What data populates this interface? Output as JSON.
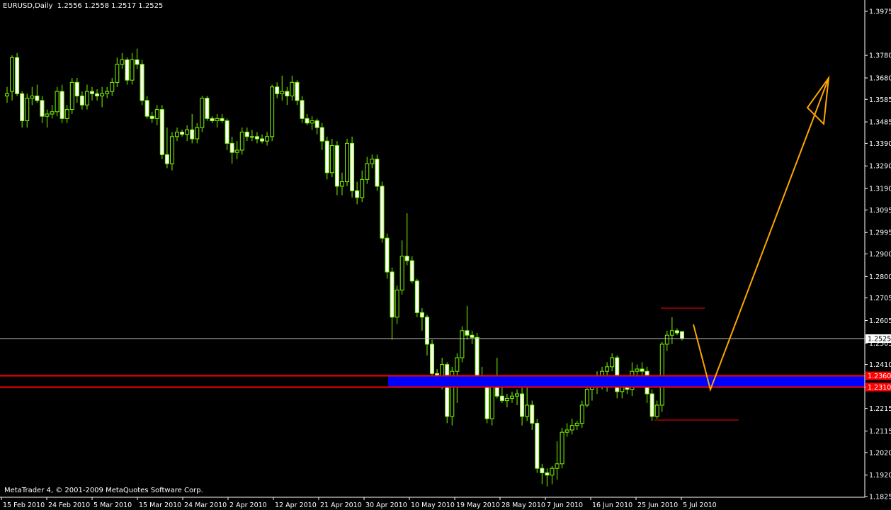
{
  "header": {
    "symbol": "EURUSD,Daily",
    "ohlc": "1.2556 1.2558 1.2517 1.2525"
  },
  "footer": {
    "copyright": "MetaTrader 4, © 2001-2009 MetaQuotes Software Corp."
  },
  "colors": {
    "background": "#000000",
    "candle": "#7CFC00",
    "candle_bull_body": "#000000",
    "candle_bear_body": "#FFFFFF",
    "support_band": "#0000FF",
    "support_lines": "#FF0000",
    "projection": "#FFA500",
    "price_line": "#C0C0C0",
    "axis_text": "#FFFFFF"
  },
  "chart_data": {
    "type": "candlestick",
    "symbol": "EURUSD",
    "timeframe": "Daily",
    "ylim": [
      1.1825,
      1.3975
    ],
    "y_ticks": [
      "1.3975",
      "1.3780",
      "1.3680",
      "1.3585",
      "1.3485",
      "1.3390",
      "1.3290",
      "1.3190",
      "1.3095",
      "1.2995",
      "1.2900",
      "1.2800",
      "1.2705",
      "1.2605",
      "1.2505",
      "1.2410",
      "1.2310",
      "1.2215",
      "1.2115",
      "1.2020",
      "1.1920",
      "1.1825"
    ],
    "x_ticks": [
      "15 Feb 2010",
      "24 Feb 2010",
      "5 Mar 2010",
      "15 Mar 2010",
      "24 Mar 2010",
      "2 Apr 2010",
      "12 Apr 2010",
      "21 Apr 2010",
      "30 Apr 2010",
      "10 May 2010",
      "19 May 2010",
      "28 May 2010",
      "7 Jun 2010",
      "16 Jun 2010",
      "25 Jun 2010",
      "5 Jul 2010"
    ],
    "current_price": "1.2525",
    "levels": [
      {
        "label": "1.2360",
        "price": 1.236
      },
      {
        "label": "1.2310",
        "price": 1.231
      }
    ],
    "zone_band": {
      "top": 1.236,
      "bottom": 1.231
    },
    "candles": [
      {
        "o": 1.36,
        "h": 1.364,
        "l": 1.357,
        "c": 1.361
      },
      {
        "o": 1.362,
        "h": 1.378,
        "l": 1.358,
        "c": 1.377
      },
      {
        "o": 1.377,
        "h": 1.379,
        "l": 1.36,
        "c": 1.361
      },
      {
        "o": 1.361,
        "h": 1.362,
        "l": 1.346,
        "c": 1.349
      },
      {
        "o": 1.349,
        "h": 1.361,
        "l": 1.346,
        "c": 1.359
      },
      {
        "o": 1.359,
        "h": 1.364,
        "l": 1.356,
        "c": 1.36
      },
      {
        "o": 1.36,
        "h": 1.365,
        "l": 1.357,
        "c": 1.358
      },
      {
        "o": 1.358,
        "h": 1.36,
        "l": 1.348,
        "c": 1.351
      },
      {
        "o": 1.351,
        "h": 1.354,
        "l": 1.346,
        "c": 1.352
      },
      {
        "o": 1.352,
        "h": 1.356,
        "l": 1.35,
        "c": 1.353
      },
      {
        "o": 1.353,
        "h": 1.364,
        "l": 1.351,
        "c": 1.362
      },
      {
        "o": 1.362,
        "h": 1.365,
        "l": 1.348,
        "c": 1.35
      },
      {
        "o": 1.35,
        "h": 1.356,
        "l": 1.348,
        "c": 1.354
      },
      {
        "o": 1.354,
        "h": 1.368,
        "l": 1.352,
        "c": 1.366
      },
      {
        "o": 1.366,
        "h": 1.368,
        "l": 1.357,
        "c": 1.36
      },
      {
        "o": 1.36,
        "h": 1.362,
        "l": 1.354,
        "c": 1.356
      },
      {
        "o": 1.356,
        "h": 1.365,
        "l": 1.354,
        "c": 1.362
      },
      {
        "o": 1.362,
        "h": 1.364,
        "l": 1.358,
        "c": 1.361
      },
      {
        "o": 1.361,
        "h": 1.363,
        "l": 1.358,
        "c": 1.36
      },
      {
        "o": 1.36,
        "h": 1.364,
        "l": 1.355,
        "c": 1.361
      },
      {
        "o": 1.361,
        "h": 1.364,
        "l": 1.359,
        "c": 1.362
      },
      {
        "o": 1.362,
        "h": 1.368,
        "l": 1.36,
        "c": 1.366
      },
      {
        "o": 1.366,
        "h": 1.377,
        "l": 1.364,
        "c": 1.374
      },
      {
        "o": 1.374,
        "h": 1.379,
        "l": 1.372,
        "c": 1.376
      },
      {
        "o": 1.376,
        "h": 1.377,
        "l": 1.365,
        "c": 1.367
      },
      {
        "o": 1.367,
        "h": 1.379,
        "l": 1.365,
        "c": 1.376
      },
      {
        "o": 1.376,
        "h": 1.381,
        "l": 1.372,
        "c": 1.374
      },
      {
        "o": 1.374,
        "h": 1.376,
        "l": 1.356,
        "c": 1.358
      },
      {
        "o": 1.358,
        "h": 1.36,
        "l": 1.35,
        "c": 1.351
      },
      {
        "o": 1.351,
        "h": 1.353,
        "l": 1.348,
        "c": 1.35
      },
      {
        "o": 1.35,
        "h": 1.356,
        "l": 1.347,
        "c": 1.354
      },
      {
        "o": 1.354,
        "h": 1.356,
        "l": 1.332,
        "c": 1.334
      },
      {
        "o": 1.334,
        "h": 1.346,
        "l": 1.328,
        "c": 1.33
      },
      {
        "o": 1.33,
        "h": 1.344,
        "l": 1.327,
        "c": 1.342
      },
      {
        "o": 1.342,
        "h": 1.346,
        "l": 1.34,
        "c": 1.344
      },
      {
        "o": 1.344,
        "h": 1.345,
        "l": 1.342,
        "c": 1.343
      },
      {
        "o": 1.343,
        "h": 1.347,
        "l": 1.34,
        "c": 1.345
      },
      {
        "o": 1.345,
        "h": 1.352,
        "l": 1.339,
        "c": 1.341
      },
      {
        "o": 1.341,
        "h": 1.348,
        "l": 1.339,
        "c": 1.346
      },
      {
        "o": 1.346,
        "h": 1.36,
        "l": 1.344,
        "c": 1.359
      },
      {
        "o": 1.359,
        "h": 1.36,
        "l": 1.349,
        "c": 1.35
      },
      {
        "o": 1.35,
        "h": 1.351,
        "l": 1.348,
        "c": 1.349
      },
      {
        "o": 1.349,
        "h": 1.352,
        "l": 1.346,
        "c": 1.35
      },
      {
        "o": 1.35,
        "h": 1.352,
        "l": 1.348,
        "c": 1.349
      },
      {
        "o": 1.349,
        "h": 1.35,
        "l": 1.336,
        "c": 1.339
      },
      {
        "o": 1.339,
        "h": 1.342,
        "l": 1.33,
        "c": 1.335
      },
      {
        "o": 1.335,
        "h": 1.34,
        "l": 1.332,
        "c": 1.336
      },
      {
        "o": 1.336,
        "h": 1.346,
        "l": 1.334,
        "c": 1.344
      },
      {
        "o": 1.344,
        "h": 1.346,
        "l": 1.34,
        "c": 1.342
      },
      {
        "o": 1.342,
        "h": 1.345,
        "l": 1.34,
        "c": 1.342
      },
      {
        "o": 1.342,
        "h": 1.344,
        "l": 1.339,
        "c": 1.341
      },
      {
        "o": 1.341,
        "h": 1.343,
        "l": 1.339,
        "c": 1.34
      },
      {
        "o": 1.34,
        "h": 1.344,
        "l": 1.338,
        "c": 1.342
      },
      {
        "o": 1.342,
        "h": 1.365,
        "l": 1.34,
        "c": 1.364
      },
      {
        "o": 1.364,
        "h": 1.366,
        "l": 1.359,
        "c": 1.361
      },
      {
        "o": 1.361,
        "h": 1.369,
        "l": 1.358,
        "c": 1.362
      },
      {
        "o": 1.362,
        "h": 1.364,
        "l": 1.356,
        "c": 1.36
      },
      {
        "o": 1.36,
        "h": 1.369,
        "l": 1.358,
        "c": 1.366
      },
      {
        "o": 1.366,
        "h": 1.367,
        "l": 1.356,
        "c": 1.358
      },
      {
        "o": 1.358,
        "h": 1.36,
        "l": 1.348,
        "c": 1.35
      },
      {
        "o": 1.35,
        "h": 1.352,
        "l": 1.347,
        "c": 1.348
      },
      {
        "o": 1.348,
        "h": 1.351,
        "l": 1.345,
        "c": 1.349
      },
      {
        "o": 1.349,
        "h": 1.35,
        "l": 1.343,
        "c": 1.346
      },
      {
        "o": 1.346,
        "h": 1.348,
        "l": 1.336,
        "c": 1.34
      },
      {
        "o": 1.34,
        "h": 1.342,
        "l": 1.323,
        "c": 1.326
      },
      {
        "o": 1.326,
        "h": 1.341,
        "l": 1.324,
        "c": 1.338
      },
      {
        "o": 1.338,
        "h": 1.34,
        "l": 1.316,
        "c": 1.32
      },
      {
        "o": 1.32,
        "h": 1.326,
        "l": 1.316,
        "c": 1.322
      },
      {
        "o": 1.322,
        "h": 1.341,
        "l": 1.32,
        "c": 1.339
      },
      {
        "o": 1.339,
        "h": 1.342,
        "l": 1.315,
        "c": 1.318
      },
      {
        "o": 1.318,
        "h": 1.322,
        "l": 1.312,
        "c": 1.315
      },
      {
        "o": 1.315,
        "h": 1.327,
        "l": 1.313,
        "c": 1.323
      },
      {
        "o": 1.323,
        "h": 1.333,
        "l": 1.321,
        "c": 1.33
      },
      {
        "o": 1.33,
        "h": 1.334,
        "l": 1.328,
        "c": 1.332
      },
      {
        "o": 1.332,
        "h": 1.334,
        "l": 1.318,
        "c": 1.32
      },
      {
        "o": 1.32,
        "h": 1.322,
        "l": 1.295,
        "c": 1.297
      },
      {
        "o": 1.297,
        "h": 1.299,
        "l": 1.279,
        "c": 1.282
      },
      {
        "o": 1.282,
        "h": 1.284,
        "l": 1.252,
        "c": 1.262
      },
      {
        "o": 1.262,
        "h": 1.276,
        "l": 1.259,
        "c": 1.274
      },
      {
        "o": 1.274,
        "h": 1.296,
        "l": 1.272,
        "c": 1.289
      },
      {
        "o": 1.289,
        "h": 1.308,
        "l": 1.285,
        "c": 1.287
      },
      {
        "o": 1.287,
        "h": 1.289,
        "l": 1.277,
        "c": 1.278
      },
      {
        "o": 1.278,
        "h": 1.279,
        "l": 1.262,
        "c": 1.264
      },
      {
        "o": 1.264,
        "h": 1.266,
        "l": 1.256,
        "c": 1.262
      },
      {
        "o": 1.262,
        "h": 1.263,
        "l": 1.245,
        "c": 1.25
      },
      {
        "o": 1.25,
        "h": 1.252,
        "l": 1.235,
        "c": 1.237
      },
      {
        "o": 1.237,
        "h": 1.239,
        "l": 1.234,
        "c": 1.236
      },
      {
        "o": 1.236,
        "h": 1.244,
        "l": 1.23,
        "c": 1.241
      },
      {
        "o": 1.241,
        "h": 1.242,
        "l": 1.215,
        "c": 1.218
      },
      {
        "o": 1.218,
        "h": 1.24,
        "l": 1.214,
        "c": 1.238
      },
      {
        "o": 1.238,
        "h": 1.246,
        "l": 1.224,
        "c": 1.244
      },
      {
        "o": 1.244,
        "h": 1.258,
        "l": 1.242,
        "c": 1.256
      },
      {
        "o": 1.256,
        "h": 1.267,
        "l": 1.252,
        "c": 1.254
      },
      {
        "o": 1.254,
        "h": 1.256,
        "l": 1.25,
        "c": 1.253
      },
      {
        "o": 1.253,
        "h": 1.255,
        "l": 1.233,
        "c": 1.235
      },
      {
        "o": 1.235,
        "h": 1.24,
        "l": 1.231,
        "c": 1.234
      },
      {
        "o": 1.234,
        "h": 1.236,
        "l": 1.215,
        "c": 1.217
      },
      {
        "o": 1.217,
        "h": 1.236,
        "l": 1.214,
        "c": 1.233
      },
      {
        "o": 1.233,
        "h": 1.244,
        "l": 1.226,
        "c": 1.227
      },
      {
        "o": 1.227,
        "h": 1.233,
        "l": 1.224,
        "c": 1.225
      },
      {
        "o": 1.225,
        "h": 1.228,
        "l": 1.222,
        "c": 1.226
      },
      {
        "o": 1.226,
        "h": 1.229,
        "l": 1.224,
        "c": 1.227
      },
      {
        "o": 1.227,
        "h": 1.23,
        "l": 1.223,
        "c": 1.228
      },
      {
        "o": 1.228,
        "h": 1.231,
        "l": 1.214,
        "c": 1.218
      },
      {
        "o": 1.218,
        "h": 1.234,
        "l": 1.216,
        "c": 1.223
      },
      {
        "o": 1.223,
        "h": 1.225,
        "l": 1.212,
        "c": 1.215
      },
      {
        "o": 1.215,
        "h": 1.217,
        "l": 1.193,
        "c": 1.195
      },
      {
        "o": 1.195,
        "h": 1.197,
        "l": 1.188,
        "c": 1.193
      },
      {
        "o": 1.193,
        "h": 1.195,
        "l": 1.187,
        "c": 1.192
      },
      {
        "o": 1.192,
        "h": 1.196,
        "l": 1.188,
        "c": 1.195
      },
      {
        "o": 1.195,
        "h": 1.207,
        "l": 1.19,
        "c": 1.197
      },
      {
        "o": 1.197,
        "h": 1.213,
        "l": 1.195,
        "c": 1.211
      },
      {
        "o": 1.211,
        "h": 1.215,
        "l": 1.209,
        "c": 1.212
      },
      {
        "o": 1.212,
        "h": 1.217,
        "l": 1.21,
        "c": 1.214
      },
      {
        "o": 1.214,
        "h": 1.216,
        "l": 1.212,
        "c": 1.215
      },
      {
        "o": 1.215,
        "h": 1.225,
        "l": 1.213,
        "c": 1.223
      },
      {
        "o": 1.223,
        "h": 1.234,
        "l": 1.222,
        "c": 1.23
      },
      {
        "o": 1.23,
        "h": 1.233,
        "l": 1.225,
        "c": 1.231
      },
      {
        "o": 1.231,
        "h": 1.238,
        "l": 1.228,
        "c": 1.236
      },
      {
        "o": 1.236,
        "h": 1.24,
        "l": 1.23,
        "c": 1.238
      },
      {
        "o": 1.238,
        "h": 1.242,
        "l": 1.229,
        "c": 1.24
      },
      {
        "o": 1.24,
        "h": 1.246,
        "l": 1.238,
        "c": 1.244
      },
      {
        "o": 1.244,
        "h": 1.245,
        "l": 1.226,
        "c": 1.229
      },
      {
        "o": 1.229,
        "h": 1.234,
        "l": 1.226,
        "c": 1.233
      },
      {
        "o": 1.233,
        "h": 1.236,
        "l": 1.228,
        "c": 1.23
      },
      {
        "o": 1.23,
        "h": 1.242,
        "l": 1.227,
        "c": 1.238
      },
      {
        "o": 1.238,
        "h": 1.241,
        "l": 1.234,
        "c": 1.239
      },
      {
        "o": 1.239,
        "h": 1.242,
        "l": 1.236,
        "c": 1.238
      },
      {
        "o": 1.238,
        "h": 1.24,
        "l": 1.224,
        "c": 1.228
      },
      {
        "o": 1.228,
        "h": 1.23,
        "l": 1.216,
        "c": 1.218
      },
      {
        "o": 1.218,
        "h": 1.225,
        "l": 1.217,
        "c": 1.223
      },
      {
        "o": 1.223,
        "h": 1.251,
        "l": 1.22,
        "c": 1.25
      },
      {
        "o": 1.25,
        "h": 1.256,
        "l": 1.247,
        "c": 1.254
      },
      {
        "o": 1.254,
        "h": 1.262,
        "l": 1.25,
        "c": 1.256
      },
      {
        "o": 1.256,
        "h": 1.257,
        "l": 1.254,
        "c": 1.255
      },
      {
        "o": 1.2556,
        "h": 1.2558,
        "l": 1.2517,
        "c": 1.2525
      }
    ]
  }
}
